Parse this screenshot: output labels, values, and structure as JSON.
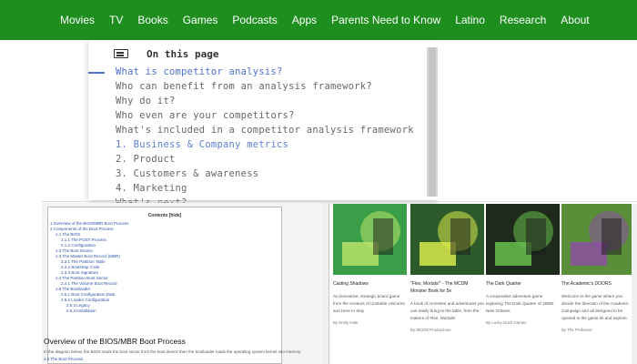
{
  "nav": {
    "items": [
      "Movies",
      "TV",
      "Books",
      "Games",
      "Podcasts",
      "Apps",
      "Parents Need to Know",
      "Latino",
      "Research",
      "About"
    ]
  },
  "toc": {
    "heading": "On this page",
    "items": [
      {
        "text": "What is competitor analysis?",
        "style": "active"
      },
      {
        "text": "Who can benefit from an analysis framework?",
        "style": "plain"
      },
      {
        "text": "Why do it?",
        "style": "plain"
      },
      {
        "text": "Who even are your competitors?",
        "style": "plain"
      },
      {
        "text": "What's included in a competitor analysis framework",
        "style": "plain"
      },
      {
        "text": "1. Business & Company metrics",
        "style": "num"
      },
      {
        "text": "2. Product",
        "style": "plain"
      },
      {
        "text": "3. Customers & awareness",
        "style": "plain"
      },
      {
        "text": "4. Marketing",
        "style": "plain"
      },
      {
        "text": "What's next?",
        "style": "plain"
      }
    ]
  },
  "doc": {
    "contents_title": "Contents [hide]",
    "lines": [
      {
        "text": "1 Overview of the BIOS/MBR Boot Process",
        "level": 1
      },
      {
        "text": "2 Components of the Boot Process",
        "level": 1
      },
      {
        "text": "2.1 The BIOS",
        "level": 2
      },
      {
        "text": "2.1.1 The POST Process",
        "level": 3
      },
      {
        "text": "2.1.2 Configuration",
        "level": 3
      },
      {
        "text": "2.2 The Boot Device",
        "level": 2
      },
      {
        "text": "2.3 The Master Boot Record (MBR)",
        "level": 2
      },
      {
        "text": "2.3.1 The Partition Table",
        "level": 3
      },
      {
        "text": "2.3.2 Bootstrap Code",
        "level": 3
      },
      {
        "text": "2.3.3 Boot Signature",
        "level": 3
      },
      {
        "text": "2.4 The Partition Boot Sector",
        "level": 2
      },
      {
        "text": "2.4.1 The Volume Boot Record",
        "level": 3
      },
      {
        "text": "2.5 The Bootloader",
        "level": 2
      },
      {
        "text": "2.5.1 Boot Configuration Data",
        "level": 3
      },
      {
        "text": "2.5.2 Loader Configuration",
        "level": 3
      },
      {
        "text": "2.5.3 Legacy",
        "level": 4
      },
      {
        "text": "2.5.4 Installation",
        "level": 4
      }
    ],
    "heading": "Overview of the BIOS/MBR Boot Process",
    "sub": "In the diagram below, the BIOS reads the boot sector from the boot device then the bootloader loads the operating system kernel into memory",
    "foot": "2.6 The Boot Process"
  },
  "cards": [
    {
      "title": "Casting Shadows",
      "desc": "An innovative, strategic board game from the creators of Unstable Unicorns and Here to Slay",
      "author": "By Emily Hale",
      "colors": {
        "bg": "#3a9d47",
        "accent": "#b7e36a"
      }
    },
    {
      "title": "\"Flex, Mortals!\" - The MCDM Monster Book for 5e",
      "desc": "A book of monsters and adventures you can easily bring to the table, from the makers of Flee, Mortals!",
      "author": "By MCDM Productions",
      "colors": {
        "bg": "#2c5a2a",
        "accent": "#d8e94a"
      }
    },
    {
      "title": "The Dark Quarter",
      "desc": "A cooperative adventure game exploring The Dark Quarter of 1980s New Orleans",
      "author": "By Lucky Duck Games",
      "colors": {
        "bg": "#1d2a1c",
        "accent": "#68c04d"
      }
    },
    {
      "title": "The Academic's DOORS",
      "desc": "Welcome to the game where you decide the direction of the Academic Campaign and all designed to be opened in the game kit and explore",
      "author": "By The Professor",
      "colors": {
        "bg": "#5a8f3a",
        "accent": "#8c4fa0"
      }
    }
  ]
}
